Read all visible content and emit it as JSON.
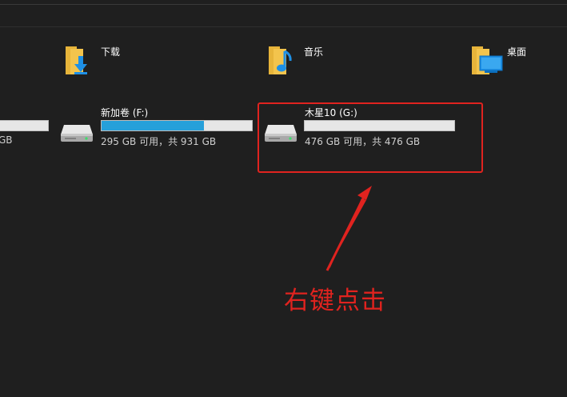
{
  "folders": [
    {
      "label": "下载",
      "icon": "download-folder-icon"
    },
    {
      "label": "音乐",
      "icon": "music-folder-icon"
    },
    {
      "label": "桌面",
      "icon": "desktop-folder-icon"
    }
  ],
  "drives": [
    {
      "name": "",
      "space": "GB",
      "used_fraction": 0.0,
      "icon": "hard-drive-icon"
    },
    {
      "name": "新加卷 (F:)",
      "space": "295 GB 可用，共 931 GB",
      "used_fraction": 0.68,
      "icon": "hard-drive-icon"
    },
    {
      "name": "木星10 (G:)",
      "space": "476 GB 可用，共 476 GB",
      "used_fraction": 0.0,
      "icon": "hard-drive-icon"
    }
  ],
  "annotation": {
    "text": "右键点击",
    "color": "#e0231f"
  },
  "colors": {
    "background": "#1f1f1f",
    "progress_fill": "#26a0da",
    "progress_track": "#e6e6e6",
    "folder_yellow": "#f3c44d",
    "accent_blue": "#1e90e6"
  }
}
